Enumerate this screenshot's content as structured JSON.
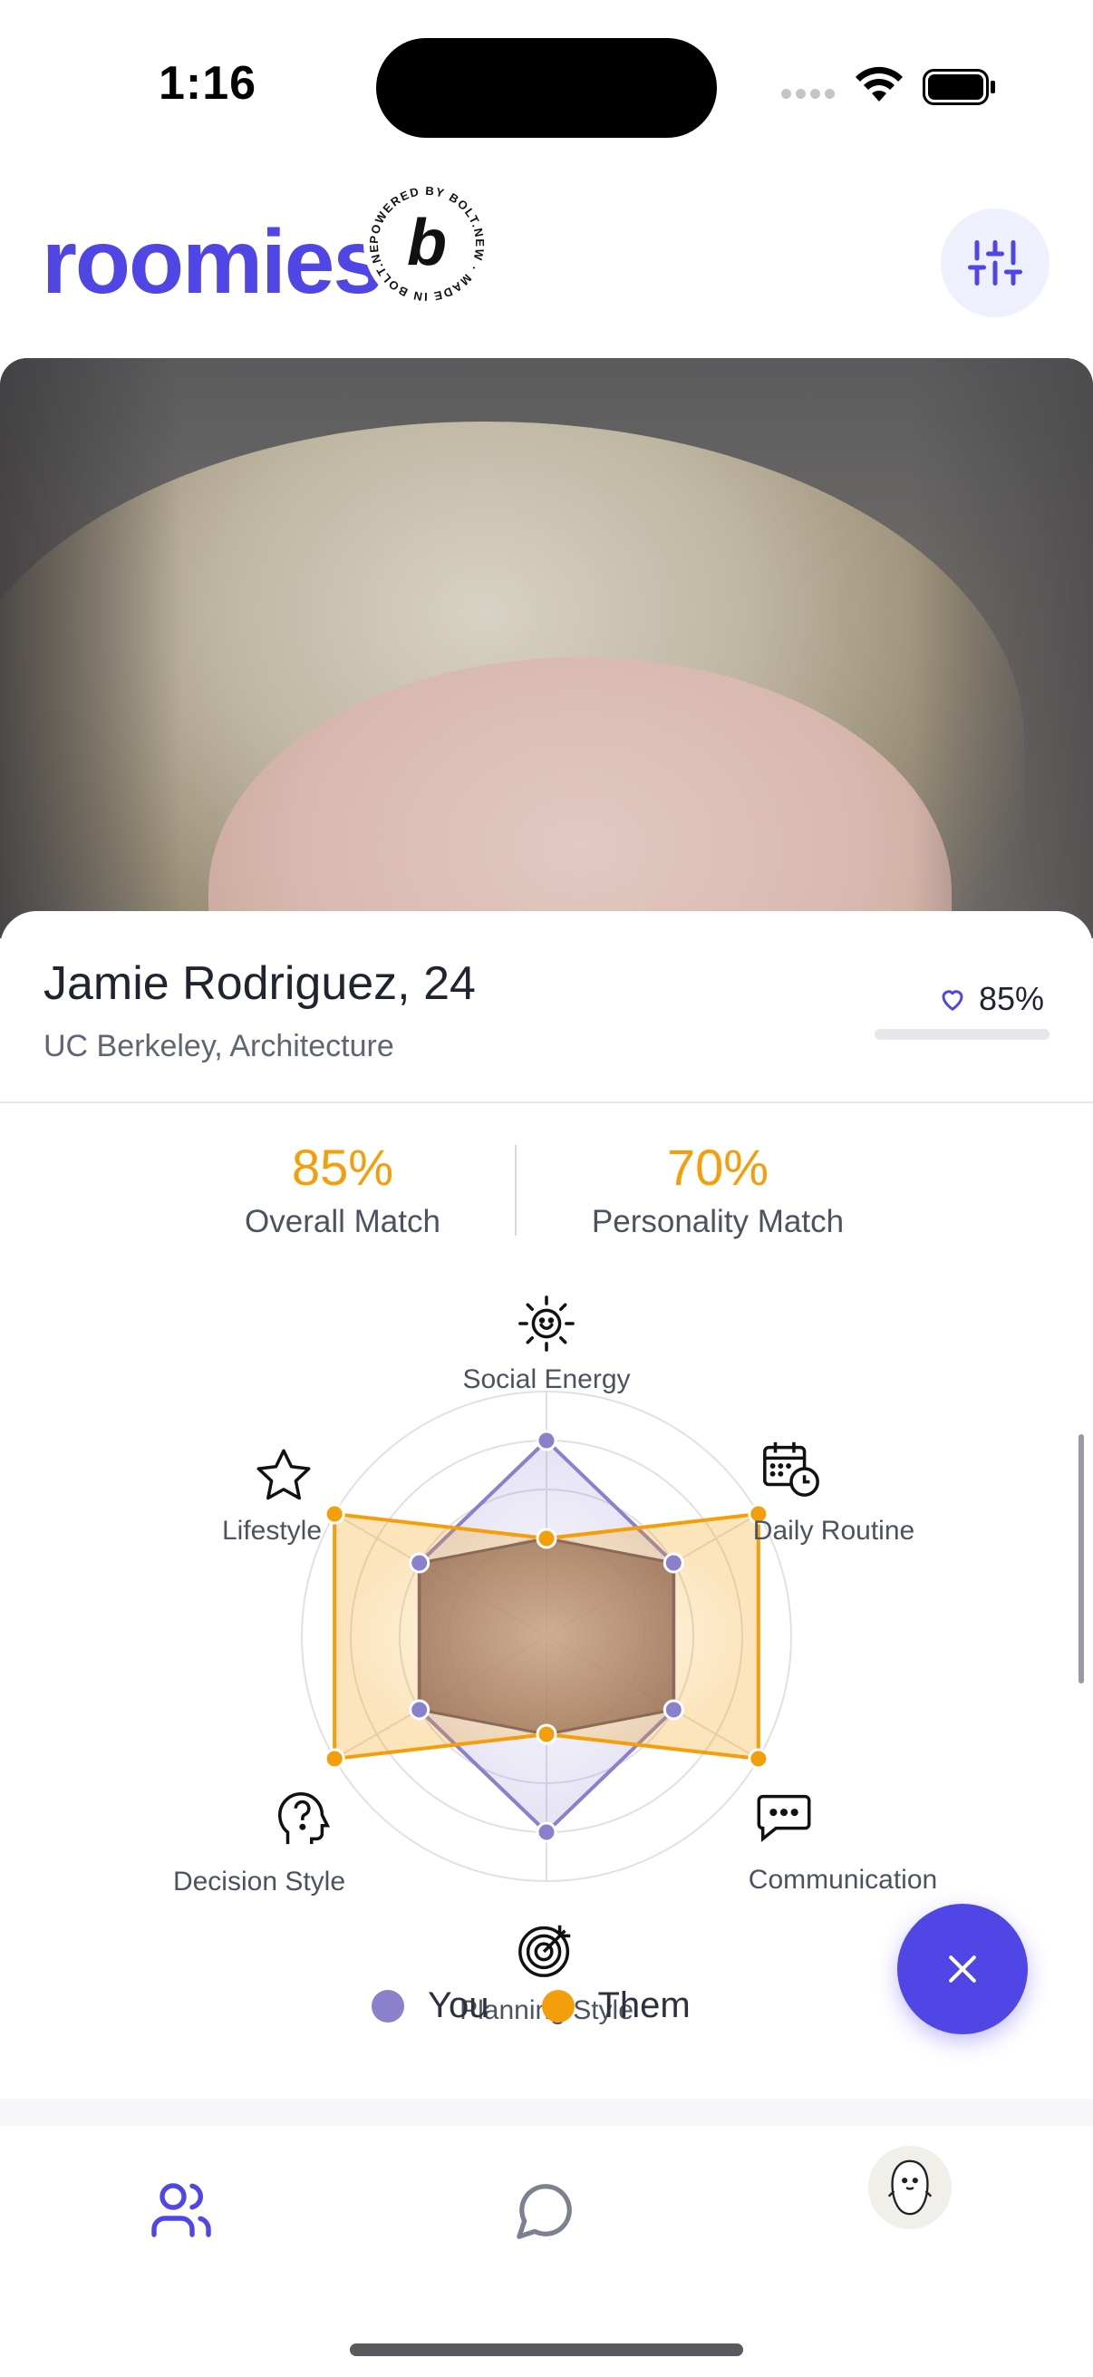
{
  "status_bar": {
    "time": "1:16"
  },
  "header": {
    "logo": "roomies",
    "badge_text": "POWERED BY BOLT.NEW · MADE IN BOLT.NEW ·",
    "badge_letter": "b"
  },
  "profile": {
    "name": "Jamie Rodriguez, 24",
    "school": "UC Berkeley, Architecture",
    "match_badge": "85%",
    "match_fraction": 0.0
  },
  "stats": {
    "overall_value": "85%",
    "overall_label": "Overall Match",
    "personality_value": "70%",
    "personality_label": "Personality Match"
  },
  "chart_data": {
    "type": "radar",
    "axes": [
      "Social Energy",
      "Daily Routine",
      "Communication",
      "Planning Style",
      "Decision Style",
      "Lifestyle"
    ],
    "scale_max": 5,
    "series": [
      {
        "name": "You",
        "color": "#8b80cc",
        "values": [
          4,
          3,
          3,
          4,
          3,
          3
        ]
      },
      {
        "name": "Them",
        "color": "#f59e0b",
        "values": [
          2,
          5,
          5,
          2,
          5,
          5
        ]
      }
    ]
  },
  "legend": {
    "you": "You",
    "them": "Them"
  },
  "colors": {
    "brand": "#4f46e5",
    "accent": "#f59e0b",
    "you": "#8b80cc"
  }
}
